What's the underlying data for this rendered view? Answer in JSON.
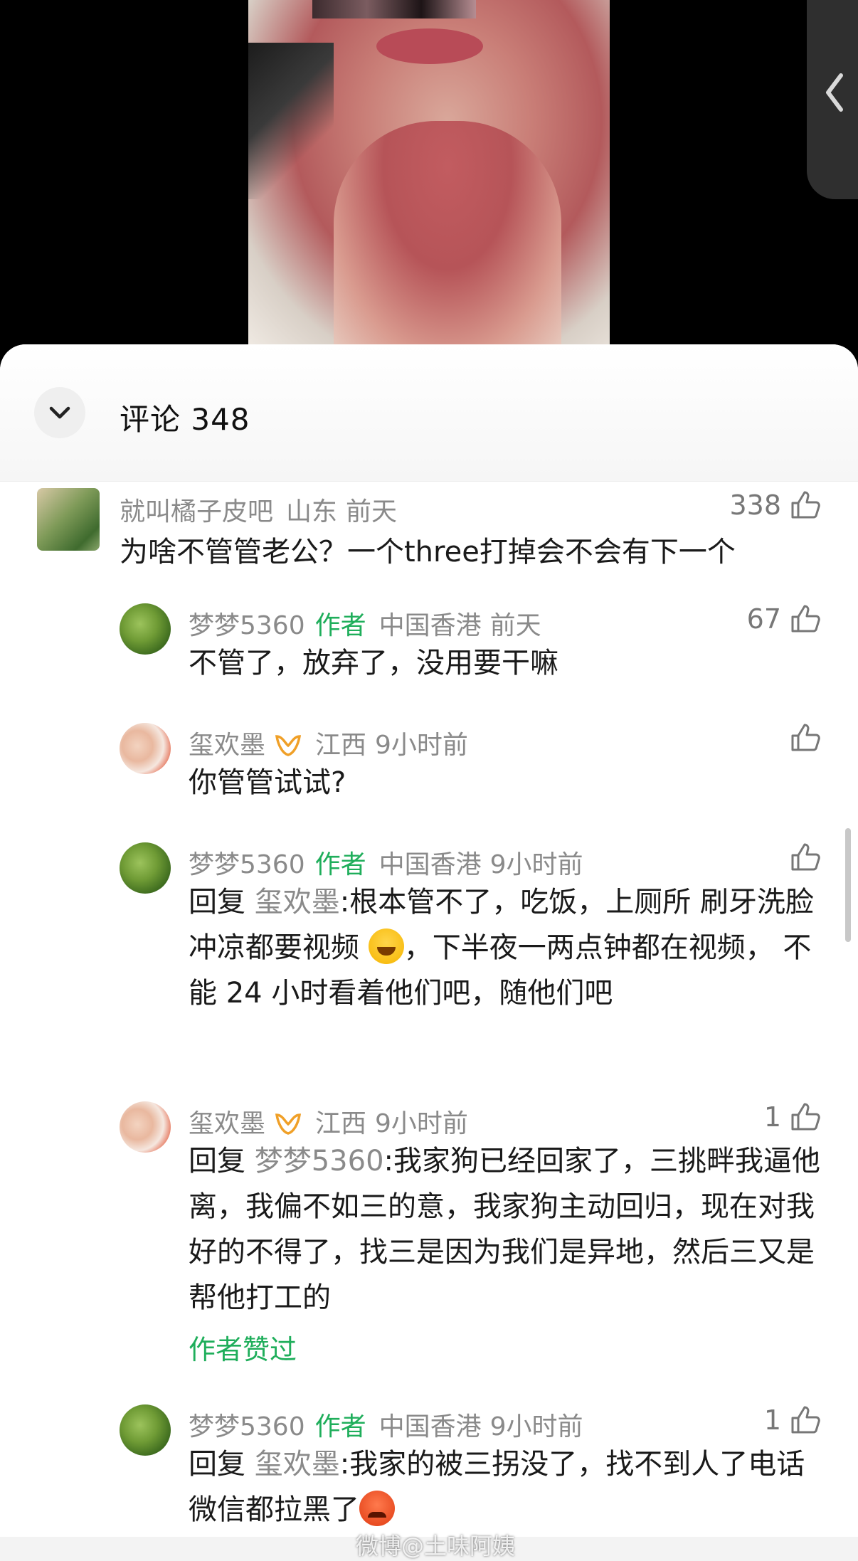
{
  "header": {
    "title": "评论 348"
  },
  "comments": [
    {
      "name": "就叫橘子皮吧",
      "location": "山东",
      "time": "前天",
      "likes": "338",
      "text": "为啥不管管老公？一个three打掉会不会有下一个"
    },
    {
      "name": "梦梦5360",
      "author_tag": "作者",
      "location": "中国香港",
      "time": "前天",
      "likes": "67",
      "text": "不管了，放弃了，没用要干嘛"
    },
    {
      "name": "玺欢墨",
      "location": "江西",
      "time": "9小时前",
      "likes": "",
      "text": "你管管试试?"
    },
    {
      "name": "梦梦5360",
      "author_tag": "作者",
      "location": "中国香港",
      "time": "9小时前",
      "likes": "",
      "reply_prefix": "回复 ",
      "reply_to": "玺欢墨",
      "text_a": ":根本管不了，吃饭，上厕所 刷牙洗脸 冲凉都要视频",
      "text_b": "，下半夜一两点钟都在视频， 不能 24 小时看着他们吧，随他们吧"
    },
    {
      "name": "玺欢墨",
      "location": "江西",
      "time": "9小时前",
      "likes": "1",
      "reply_prefix": "回复 ",
      "reply_to": "梦梦5360",
      "text": ":我家狗已经回家了，三挑畔我逼他离，我偏不如三的意，我家狗主动回归，现在对我好的不得了，找三是因为我们是异地，然后三又是帮他打工的",
      "author_liked": "作者赞过"
    },
    {
      "name": "梦梦5360",
      "author_tag": "作者",
      "location": "中国香港",
      "time": "9小时前",
      "likes": "1",
      "reply_prefix": "回复 ",
      "reply_to": "玺欢墨",
      "text": ":我家的被三拐没了，找不到人了电话微信都拉黑了"
    }
  ],
  "watermark": "微博@土味阿姨",
  "icons": {
    "collapse": "chevron-down-icon",
    "like": "thumbs-up-icon",
    "side_handle": "chevron-left-icon"
  },
  "colors": {
    "author_green": "#1fae5b",
    "meta_gray": "#8a8a8a"
  }
}
